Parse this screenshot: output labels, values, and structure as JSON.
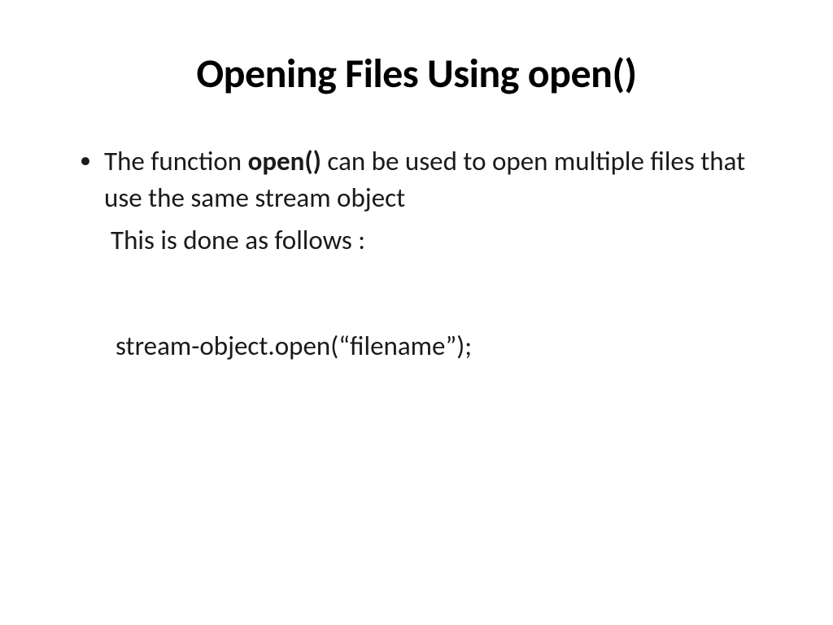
{
  "slide": {
    "title": "Opening Files Using open()",
    "bullet1": {
      "prefix": "The function ",
      "bold": "open()",
      "suffix": " can be used to open multiple files that use the same stream object"
    },
    "line2": "This is done as follows :",
    "codeLine": "stream-object.open(“filename”);"
  }
}
